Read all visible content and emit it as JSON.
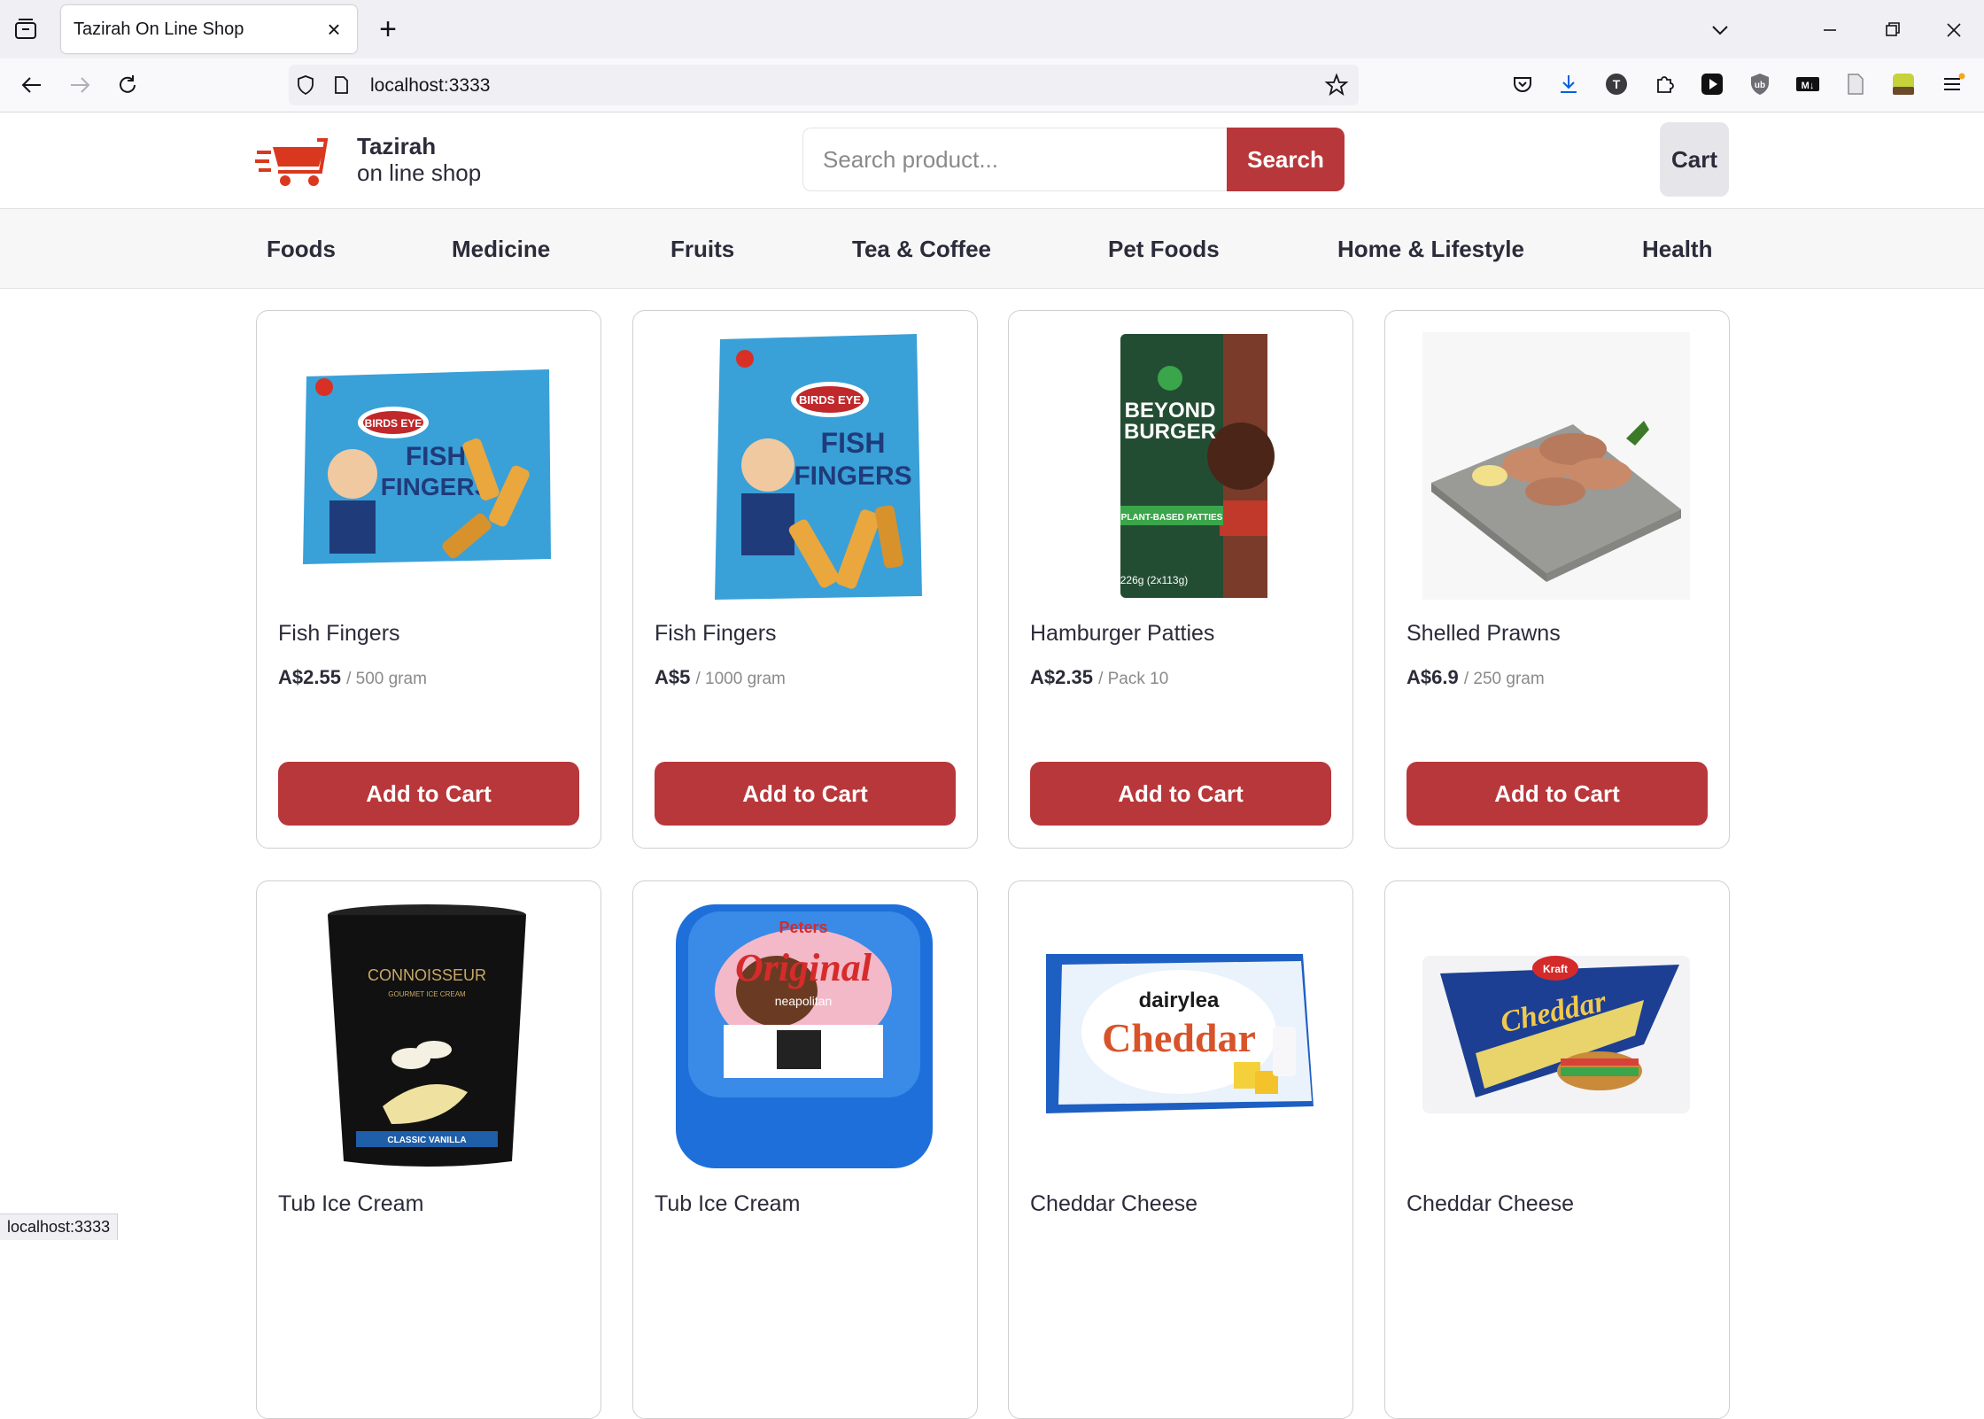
{
  "browser": {
    "tab_title": "Tazirah On Line Shop",
    "url": "localhost:3333",
    "status_url": "localhost:3333"
  },
  "site": {
    "brand_name": "Tazirah",
    "brand_sub": "on line shop",
    "search_placeholder": "Search product...",
    "search_button": "Search",
    "cart_button": "Cart",
    "accent_color": "#b8373a"
  },
  "categories": [
    "Foods",
    "Medicine",
    "Fruits",
    "Tea & Coffee",
    "Pet Foods",
    "Home & Lifestyle",
    "Health"
  ],
  "products": [
    {
      "name": "Fish Fingers",
      "price": "A$2.55",
      "unit": "/ 500 gram",
      "image": "fish-fingers-box-icon",
      "button": "Add to Cart"
    },
    {
      "name": "Fish Fingers",
      "price": "A$5",
      "unit": "/ 1000 gram",
      "image": "fish-fingers-large-box-icon",
      "button": "Add to Cart"
    },
    {
      "name": "Hamburger Patties",
      "price": "A$2.35",
      "unit": "/ Pack 10",
      "image": "burger-patties-pack-icon",
      "button": "Add to Cart"
    },
    {
      "name": "Shelled Prawns",
      "price": "A$6.9",
      "unit": "/ 250 gram",
      "image": "prawns-plate-icon",
      "button": "Add to Cart"
    },
    {
      "name": "Tub Ice Cream",
      "price": "",
      "unit": "",
      "image": "ice-cream-tub-black-icon",
      "button": ""
    },
    {
      "name": "Tub Ice Cream",
      "price": "",
      "unit": "",
      "image": "ice-cream-tub-blue-icon",
      "button": ""
    },
    {
      "name": "Cheddar Cheese",
      "price": "",
      "unit": "",
      "image": "cheddar-block-icon",
      "button": ""
    },
    {
      "name": "Cheddar Cheese",
      "price": "",
      "unit": "",
      "image": "cheddar-slices-icon",
      "button": ""
    }
  ]
}
